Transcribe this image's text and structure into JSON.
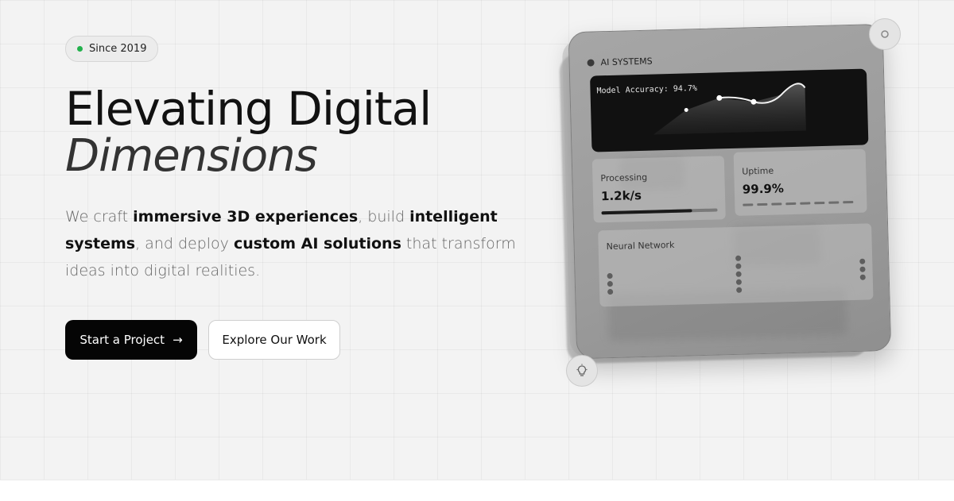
{
  "badge": {
    "label": "Since 2019",
    "dot_color": "#22b14c"
  },
  "hero": {
    "title_line1": "Elevating Digital",
    "title_line2": "Dimensions",
    "description": [
      {
        "text": "We craft ",
        "bold": false
      },
      {
        "text": "immersive 3D experiences",
        "bold": true
      },
      {
        "text": ", build ",
        "bold": false
      },
      {
        "text": "intelligent systems",
        "bold": true
      },
      {
        "text": ", and deploy ",
        "bold": false
      },
      {
        "text": "custom AI solutions",
        "bold": true
      },
      {
        "text": " that transform ideas into digital realities.",
        "bold": false
      }
    ]
  },
  "buttons": {
    "primary_label": "Start a Project",
    "primary_icon": "arrow-right-icon",
    "primary_glyph": "→",
    "secondary_label": "Explore Our Work"
  },
  "card": {
    "header": "AI SYSTEMS",
    "chart_label": "Model Accuracy: 94.7%",
    "processing_label": "Processing",
    "processing_value": "1.2k/s",
    "processing_level": 0.78,
    "uptime_label": "Uptime",
    "uptime_value": "99.9%",
    "network_label": "Neural Network"
  },
  "icons": {
    "top_right": "settings-icon",
    "bottom_left": "lightbulb-icon"
  },
  "colors": {
    "primary_button": "#050505",
    "accent_green": "#22b14c"
  }
}
